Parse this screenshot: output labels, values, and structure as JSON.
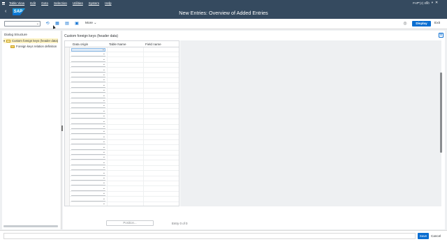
{
  "menubar": {
    "items": [
      "Table View",
      "Edit",
      "Goto",
      "Selection",
      "Utilities",
      "System",
      "Help"
    ],
    "system_info": "PHP (2) 810"
  },
  "header": {
    "title": "New Entries: Overview of Added Entries",
    "logo_text": "SAP"
  },
  "toolbar": {
    "more_label": "More",
    "more_chevron": "⌄",
    "display_label": "Display",
    "exit_label": "Exit",
    "dropdown_glyph": "⌄"
  },
  "tree": {
    "title": "Dialog Structure",
    "items": [
      {
        "label": "Custom foreign keys (header data)",
        "selected": true
      },
      {
        "label": "Foreign keys relation definition",
        "selected": false
      }
    ]
  },
  "main": {
    "section_title": "Custom foreign keys (header data)",
    "columns": [
      "Data origin",
      "Table Name",
      "Field name"
    ],
    "row_count": 31,
    "dropdown_glyph": "⌄",
    "position_button": "Position...",
    "entry_label": "Entry 0 of 0"
  },
  "footer": {
    "save_label": "Save",
    "cancel_label": "Cancel"
  },
  "colors": {
    "shell": "#354a5f",
    "accent": "#0a6ed1",
    "selected_tree": "#fdf3c3"
  }
}
